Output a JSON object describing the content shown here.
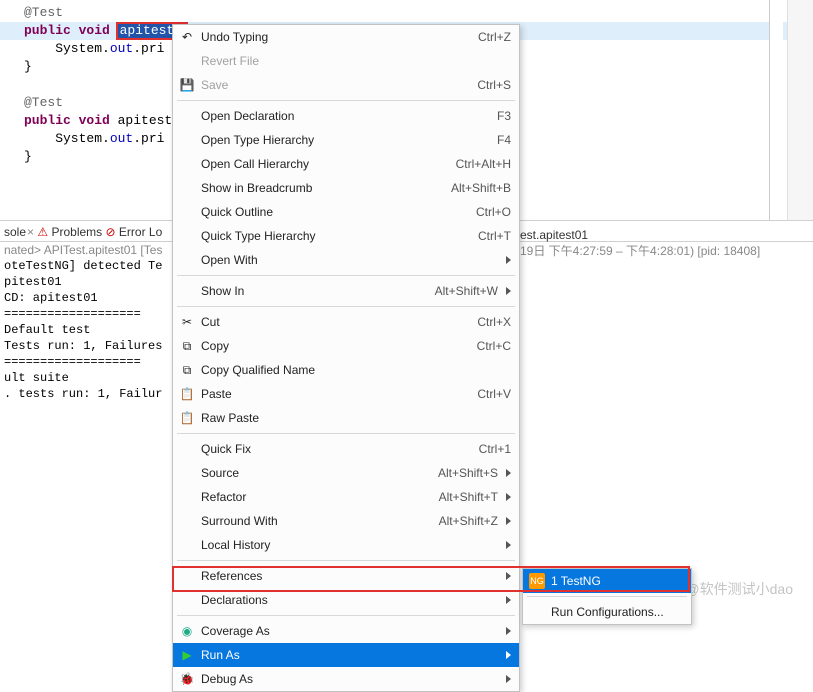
{
  "code": {
    "line1": "@Test",
    "line2_kw": "public void ",
    "line2_sel": "apitest",
    "line3_pre": "    System.",
    "line3_field": "out",
    "line3_call": ".pri",
    "line4": "}",
    "line6": "@Test",
    "line7_kw": "public void ",
    "line7_name": "apitest",
    "line8_pre": "    System.",
    "line8_field": "out",
    "line8_call": ".pri",
    "line9": "}"
  },
  "console": {
    "tabs": {
      "console": "sole",
      "problems": "Problems",
      "errorlog": "Error Lo"
    },
    "header": "nated> APITest.apitest01 [Tes",
    "line1": "oteTestNG] detected Te",
    "line2": "pitest01",
    "line3": "CD: apitest01",
    "sep": "===================",
    "line4": "Default test",
    "line5": "Tests run: 1, Failures",
    "line6": "ult suite",
    "line7": ". tests run: 1, Failur"
  },
  "menu": {
    "undo": "Undo Typing",
    "undo_sc": "Ctrl+Z",
    "revert": "Revert File",
    "save": "Save",
    "save_sc": "Ctrl+S",
    "opendecl": "Open Declaration",
    "opendecl_sc": "F3",
    "opentype": "Open Type Hierarchy",
    "opentype_sc": "F4",
    "opencall": "Open Call Hierarchy",
    "opencall_sc": "Ctrl+Alt+H",
    "breadcrumb": "Show in Breadcrumb",
    "breadcrumb_sc": "Alt+Shift+B",
    "quickoutline": "Quick Outline",
    "quickoutline_sc": "Ctrl+O",
    "quicktype": "Quick Type Hierarchy",
    "quicktype_sc": "Ctrl+T",
    "openwith": "Open With",
    "showin": "Show In",
    "showin_sc": "Alt+Shift+W",
    "cut": "Cut",
    "cut_sc": "Ctrl+X",
    "copy": "Copy",
    "copy_sc": "Ctrl+C",
    "copyqn": "Copy Qualified Name",
    "paste": "Paste",
    "paste_sc": "Ctrl+V",
    "rawpaste": "Raw Paste",
    "quickfix": "Quick Fix",
    "quickfix_sc": "Ctrl+1",
    "source": "Source",
    "source_sc": "Alt+Shift+S",
    "refactor": "Refactor",
    "refactor_sc": "Alt+Shift+T",
    "surround": "Surround With",
    "surround_sc": "Alt+Shift+Z",
    "localhist": "Local History",
    "references": "References",
    "declarations": "Declarations",
    "coverage": "Coverage As",
    "runas": "Run As",
    "debugas": "Debug As"
  },
  "submenu": {
    "testng": "1 TestNG",
    "runconfig": "Run Configurations..."
  },
  "runinfo": {
    "title": "est.apitest01",
    "desc": "19日 下午4:27:59 – 下午4:28:01) [pid: 18408]"
  },
  "watermark": "CSDN @软件测试小dao"
}
